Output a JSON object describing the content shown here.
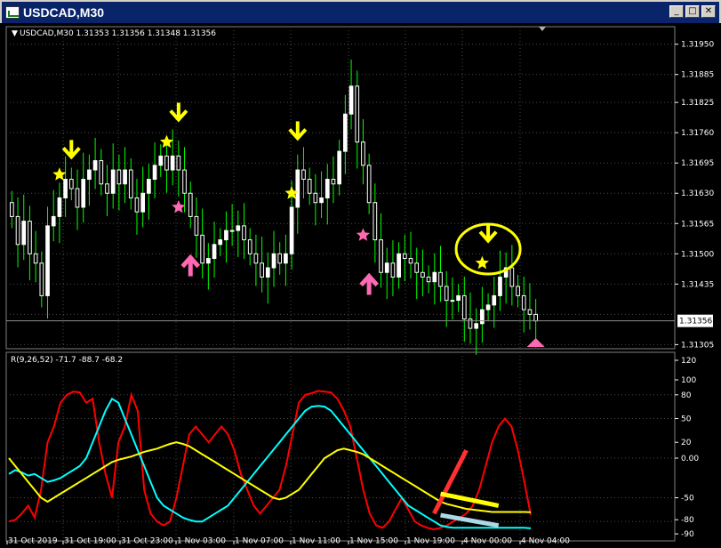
{
  "window": {
    "title": "USDCAD,M30",
    "buttons": {
      "minimize": "_",
      "maximize": "□",
      "close": "✕"
    }
  },
  "main_panel": {
    "header": "USDCAD,M30  1.31353 1.31356 1.31348 1.31356",
    "price_label": "1.31356"
  },
  "indicator_panel": {
    "header": "R(9,26,52) -71.7 -88.7 -68.2"
  },
  "chart_data": [
    {
      "type": "candlestick",
      "title": "USDCAD,M30",
      "ylim": [
        1.313,
        1.3198
      ],
      "yticks": [
        "1.31950",
        "1.31885",
        "1.31825",
        "1.31760",
        "1.31695",
        "1.31630",
        "1.31565",
        "1.31500",
        "1.31435",
        "1.31370",
        "1.31305"
      ],
      "current_price": 1.31356,
      "candle_color": "#ffffff",
      "wick_color": "#00ff00",
      "close": [
        1.3158,
        1.3152,
        1.3157,
        1.315,
        1.3148,
        1.3141,
        1.3156,
        1.3158,
        1.3162,
        1.3166,
        1.3164,
        1.316,
        1.3166,
        1.3168,
        1.317,
        1.3165,
        1.3163,
        1.3168,
        1.3165,
        1.3168,
        1.3162,
        1.3159,
        1.3163,
        1.3166,
        1.3169,
        1.3171,
        1.3168,
        1.3171,
        1.3168,
        1.3163,
        1.3158,
        1.3154,
        1.3148,
        1.3149,
        1.3152,
        1.3153,
        1.3155,
        1.3155,
        1.3156,
        1.3153,
        1.315,
        1.3148,
        1.3145,
        1.3147,
        1.315,
        1.3148,
        1.315,
        1.316,
        1.3168,
        1.3166,
        1.3163,
        1.3161,
        1.3162,
        1.3166,
        1.3165,
        1.3172,
        1.318,
        1.3186,
        1.3174,
        1.3169,
        1.3161,
        1.3153,
        1.3146,
        1.3148,
        1.3145,
        1.315,
        1.3149,
        1.3148,
        1.3146,
        1.3145,
        1.3144,
        1.3146,
        1.3143,
        1.314,
        1.314,
        1.3141,
        1.3136,
        1.3134,
        1.3135,
        1.3138,
        1.3139,
        1.3141,
        1.3145,
        1.3147,
        1.3143,
        1.3141,
        1.3138,
        1.3137,
        1.31356
      ],
      "markers": [
        {
          "type": "star",
          "color": "#ffff00",
          "index": 8,
          "price": 1.3167
        },
        {
          "type": "arrow-down",
          "color": "#ffff00",
          "index": 10,
          "price": 1.3171
        },
        {
          "type": "star",
          "color": "#ffff00",
          "index": 26,
          "price": 1.3174
        },
        {
          "type": "arrow-down",
          "color": "#ffff00",
          "index": 28,
          "price": 1.3179
        },
        {
          "type": "star",
          "color": "#ff69b4",
          "index": 28,
          "price": 1.316
        },
        {
          "type": "arrow-up",
          "color": "#ff69b4",
          "index": 30,
          "price": 1.3149
        },
        {
          "type": "star",
          "color": "#ffff00",
          "index": 47,
          "price": 1.3163
        },
        {
          "type": "arrow-down",
          "color": "#ffff00",
          "index": 48,
          "price": 1.3175
        },
        {
          "type": "star",
          "color": "#ff69b4",
          "index": 59,
          "price": 1.3154
        },
        {
          "type": "arrow-up",
          "color": "#ff69b4",
          "index": 60,
          "price": 1.3145
        },
        {
          "type": "star",
          "color": "#ffff00",
          "index": 79,
          "price": 1.3148
        },
        {
          "type": "arrow-down",
          "color": "#ffff00",
          "index": 80,
          "price": 1.3153
        },
        {
          "type": "triangle-up",
          "color": "#ff69b4",
          "index": 88,
          "price": 1.313
        }
      ],
      "highlight_ellipse": {
        "color": "#ffff00",
        "index": 80,
        "price": 1.3151
      }
    },
    {
      "type": "line",
      "title": "R(9,26,52) -71.7 -88.7 -68.2",
      "ylim": [
        -100,
        100
      ],
      "yticks": [
        "120",
        "100",
        "80",
        "50",
        "20",
        "0.00",
        "-50",
        "-80",
        "-90"
      ],
      "x_labels": [
        "31 Oct 2019",
        "31 Oct 19:00",
        "31 Oct 23:00",
        "1 Nov 03:00",
        "1 Nov 07:00",
        "1 Nov 11:00",
        "1 Nov 15:00",
        "1 Nov 19:00",
        "4 Nov 00:00",
        "4 Nov 04:00"
      ],
      "series": [
        {
          "color": "#ff0000",
          "values": [
            -80,
            -78,
            -70,
            -60,
            -75,
            -40,
            20,
            40,
            70,
            80,
            84,
            83,
            70,
            75,
            20,
            -20,
            -50,
            20,
            40,
            80,
            60,
            -40,
            -70,
            -80,
            -85,
            -80,
            -50,
            -10,
            30,
            40,
            30,
            20,
            30,
            40,
            30,
            10,
            -20,
            -40,
            -60,
            -70,
            -60,
            -50,
            -40,
            -10,
            30,
            70,
            80,
            82,
            85,
            84,
            83,
            75,
            60,
            40,
            0,
            -40,
            -70,
            -85,
            -88,
            -80,
            -65,
            -50,
            -65,
            -80,
            -85,
            -88,
            -90,
            -88,
            -85,
            -80,
            -75,
            -70,
            -60,
            -40,
            -10,
            20,
            40,
            50,
            40,
            10,
            -30,
            -71.7
          ]
        },
        {
          "color": "#00ffff",
          "values": [
            -20,
            -15,
            -18,
            -22,
            -20,
            -25,
            -30,
            -28,
            -25,
            -20,
            -15,
            -10,
            0,
            20,
            40,
            60,
            75,
            70,
            50,
            30,
            10,
            -10,
            -30,
            -50,
            -60,
            -65,
            -70,
            -75,
            -78,
            -80,
            -80,
            -75,
            -70,
            -65,
            -60,
            -50,
            -40,
            -30,
            -20,
            -10,
            0,
            10,
            20,
            30,
            40,
            50,
            60,
            65,
            66,
            65,
            60,
            50,
            40,
            30,
            20,
            10,
            0,
            -10,
            -20,
            -30,
            -40,
            -50,
            -60,
            -65,
            -70,
            -75,
            -80,
            -85,
            -87,
            -88,
            -88,
            -88,
            -88,
            -88,
            -88,
            -88,
            -88,
            -88,
            -88,
            -88,
            -88,
            -88.7
          ]
        },
        {
          "color": "#ffff00",
          "values": [
            0,
            -10,
            -20,
            -30,
            -40,
            -50,
            -55,
            -50,
            -45,
            -40,
            -35,
            -30,
            -25,
            -20,
            -15,
            -10,
            -5,
            -2,
            0,
            2,
            5,
            8,
            10,
            12,
            15,
            18,
            20,
            18,
            15,
            10,
            5,
            0,
            -5,
            -10,
            -15,
            -20,
            -25,
            -30,
            -35,
            -40,
            -45,
            -50,
            -52,
            -50,
            -45,
            -40,
            -30,
            -20,
            -10,
            0,
            5,
            10,
            12,
            10,
            8,
            5,
            0,
            -5,
            -10,
            -15,
            -20,
            -25,
            -30,
            -35,
            -40,
            -45,
            -50,
            -55,
            -58,
            -60,
            -62,
            -64,
            -65,
            -66,
            -67,
            -68,
            -68,
            -68,
            -68,
            -68,
            -68,
            -68.2
          ]
        }
      ],
      "annotations": [
        {
          "shape": "line",
          "color": "#ff3030",
          "x": [
            66,
            71
          ],
          "y": [
            -70,
            10
          ]
        },
        {
          "shape": "line",
          "color": "#ffff00",
          "x": [
            67,
            76
          ],
          "y": [
            -45,
            -60
          ]
        },
        {
          "shape": "line",
          "color": "#add8e6",
          "x": [
            67,
            76
          ],
          "y": [
            -72,
            -85
          ]
        }
      ]
    }
  ]
}
